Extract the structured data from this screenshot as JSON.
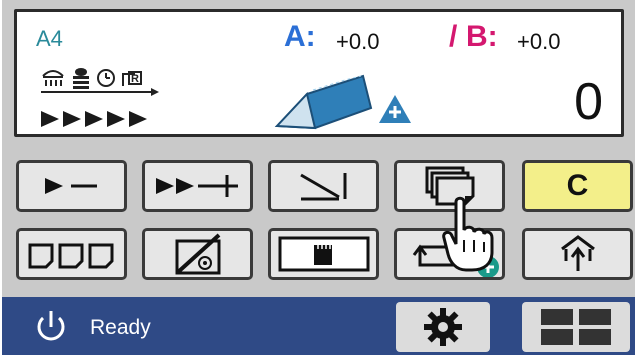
{
  "panel": {
    "paper_size": "A4",
    "adjust_a_label": "A:",
    "adjust_a_value": "+0.0",
    "adjust_b_slash": "/",
    "adjust_b_label": "B:",
    "adjust_b_value": "+0.0",
    "counter": "0",
    "accent_a": "#2b6fd6",
    "accent_b": "#d4186f"
  },
  "buttons": {
    "row1": [
      {
        "name": "speed-slower-button",
        "icon": "play-minus-icon"
      },
      {
        "name": "speed-faster-button",
        "icon": "fast-forward-plus-icon"
      },
      {
        "name": "fold-type-button",
        "icon": "fold-slope-icon"
      },
      {
        "name": "multi-sheet-button",
        "icon": "stacked-sheets-icon"
      },
      {
        "name": "clear-button",
        "label": "C"
      }
    ],
    "row2": [
      {
        "name": "fold-pattern-button",
        "icon": "fold-pattern-icon"
      },
      {
        "name": "no-crease-button",
        "icon": "no-crease-icon"
      },
      {
        "name": "memory-card-button",
        "icon": "memory-card-icon"
      },
      {
        "name": "add-program-button",
        "icon": "repeat-plus-icon"
      },
      {
        "name": "eject-button",
        "icon": "upload-arrow-icon"
      }
    ]
  },
  "statusbar": {
    "status_text": "Ready",
    "bar_color": "#2f4a86"
  }
}
